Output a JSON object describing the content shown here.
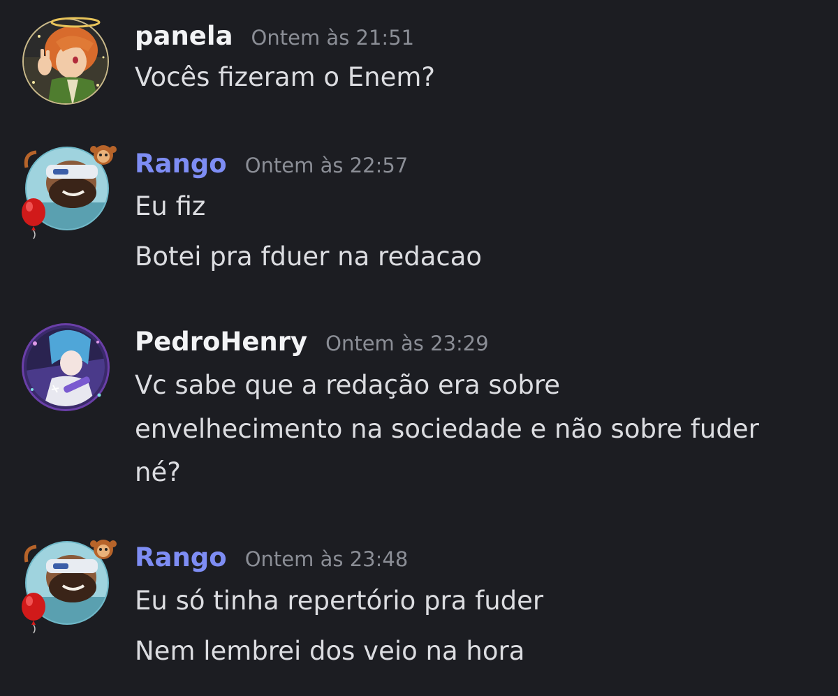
{
  "messages": [
    {
      "username": "panela",
      "timestamp": "Ontem às 21:51",
      "lines": [
        "Vocês fizeram o Enem?"
      ]
    },
    {
      "username": "Rango",
      "timestamp": "Ontem às 22:57",
      "lines": [
        "Eu fiz",
        "Botei pra fduer na redacao"
      ]
    },
    {
      "username": "PedroHenry",
      "timestamp": "Ontem às 23:29",
      "lines": [
        "Vc sabe que a redação era sobre",
        "envelhecimento na sociedade e não sobre fuder",
        "né?"
      ]
    },
    {
      "username": "Rango",
      "timestamp": "Ontem às 23:48",
      "lines": [
        "Eu só tinha repertório pra fuder",
        "Nem lembrei dos veio na hora"
      ]
    }
  ],
  "colors": {
    "background": "#1c1d22",
    "username_default": "#f2f3f5",
    "username_role": "#7e8df4",
    "timestamp": "#8b8e96",
    "message_text": "#dcdde1"
  },
  "icons": {
    "avatar_panela": "anime-girl-avatar-with-halo",
    "avatar_rango": "bearded-man-avatar-with-monkey-and-balloon",
    "avatar_pedro": "anime-character-avatar-with-purple-frame"
  }
}
